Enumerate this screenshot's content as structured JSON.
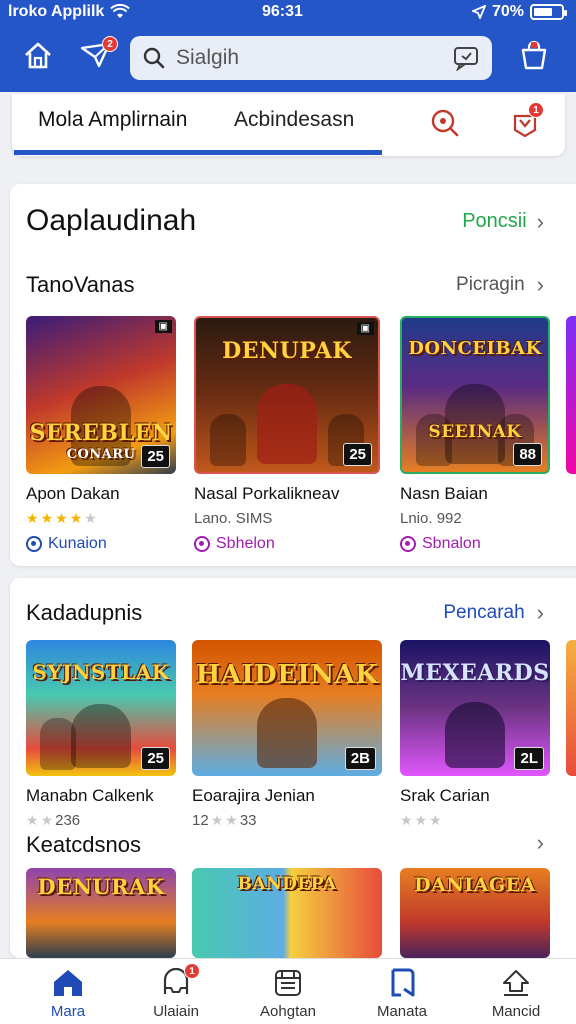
{
  "status": {
    "carrier": "lroko Applilk",
    "time": "96:31",
    "battery": "70%",
    "battery_level": 0.7
  },
  "topbar": {
    "search_placeholder": "Sialgih",
    "filter_badge": "2"
  },
  "tabs": {
    "active": "Mola Amplirnain",
    "second": "Acbindesasn",
    "gift_badge": "1"
  },
  "section1": {
    "title": "Oaplaudinah",
    "link": "Poncsii",
    "row_title": "TanoVanas",
    "row_link": "Picragin",
    "items": [
      {
        "art_title": "SEREBLEN",
        "art_sub": "CONARU",
        "art_num": "25",
        "name": "Apon Dakan",
        "stars": 4,
        "meta": "Kunaion",
        "meta_color": "blue"
      },
      {
        "art_title": "DENUPAK",
        "art_sub": "",
        "art_num": "25",
        "name": "Nasal Porkalikneav",
        "sub": "Lano. SIMS",
        "meta": "Sbhelon",
        "meta_color": "purple"
      },
      {
        "art_title": "DONCEIBAK",
        "art_sub": "SEEINAK",
        "art_num": "88",
        "name": "Nasn Baian",
        "sub": "Lnio. 992",
        "meta": "Sbnalon",
        "meta_color": "purple"
      }
    ]
  },
  "section2": {
    "title": "Kadadupnis",
    "link": "Pencarah",
    "items": [
      {
        "art_title": "SYJNSTLAK",
        "art_num": "25",
        "name": "Manabn Calkenk",
        "rating_text": "236",
        "stars": 2
      },
      {
        "art_title": "HAIDEINAK",
        "art_num": "2B",
        "name": "Eoarajira Jenian",
        "rating_text": "12",
        "rating_tail": "33",
        "stars": 2
      },
      {
        "art_title": "MEXEARDS",
        "art_num": "2L",
        "name": "Srak Carian",
        "stars": 3
      }
    ],
    "row2_title": "Keatcdsnos",
    "row2_items": [
      {
        "art_title": "DENURAK"
      },
      {
        "art_title": "BANDEPA"
      },
      {
        "art_title": "DANIAGEA"
      }
    ]
  },
  "bottom_nav": [
    {
      "label": "Mara",
      "icon": "home-icon",
      "active": true
    },
    {
      "label": "Ulaiain",
      "icon": "inbox-icon",
      "badge": "1"
    },
    {
      "label": "Aohgtan",
      "icon": "store-icon"
    },
    {
      "label": "Manata",
      "icon": "bookmark-icon"
    },
    {
      "label": "Mancid",
      "icon": "download-icon"
    }
  ],
  "colors": {
    "brand": "#2456c8",
    "link_green": "#1fa84a",
    "link_blue": "#1e4bb5",
    "accent_purple": "#a21caf"
  }
}
